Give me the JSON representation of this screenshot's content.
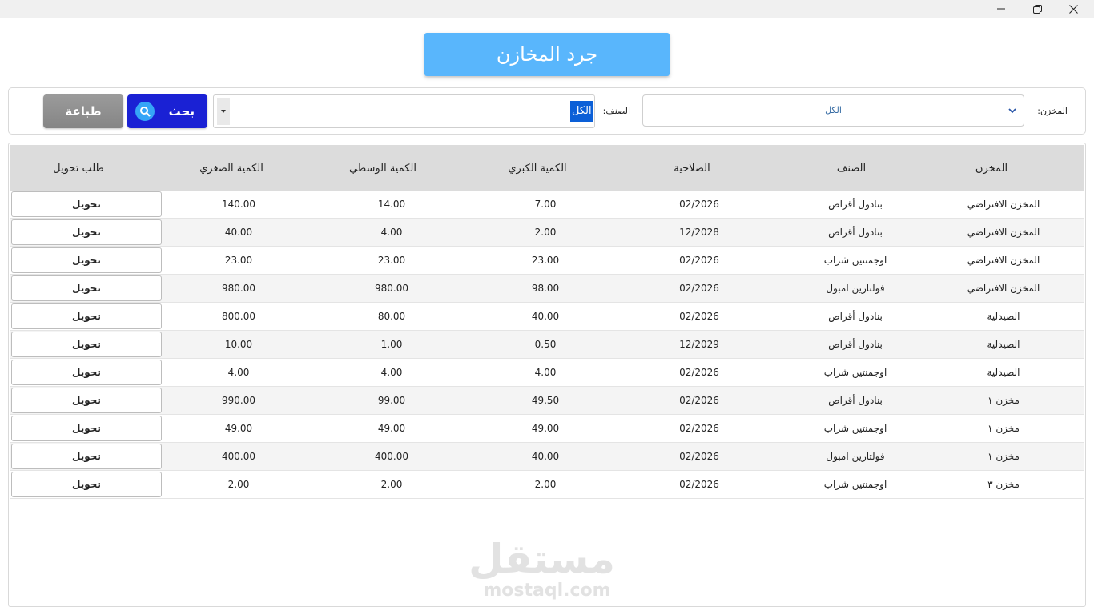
{
  "window": {
    "minimize_icon": "minimize-icon",
    "maximize_icon": "restore-icon",
    "close_icon": "close-icon"
  },
  "page_title": "جرد المخازن",
  "filters": {
    "store_label": "المخزن:",
    "store_value": "الكل",
    "class_label": "الصنف:",
    "class_value": "الكل",
    "search_label": "بحث",
    "print_label": "طباعة"
  },
  "colors": {
    "title_banner": "#59b6fc",
    "search_button": "#1a21d4",
    "print_button": "#8e8e8e",
    "selection": "#0b5fd7"
  },
  "table": {
    "headers": {
      "store": "المخزن",
      "item": "الصنف",
      "expiry": "الصلاحية",
      "qty_large": "الكمية الكبري",
      "qty_medium": "الكمية الوسطي",
      "qty_small": "الكمية الصغري",
      "transfer": "طلب تحويل"
    },
    "transfer_label": "تحويل",
    "rows": [
      {
        "store": "المخزن الافتراضي",
        "item": "بنادول أقراص",
        "expiry": "02/2026",
        "qty_large": "7.00",
        "qty_medium": "14.00",
        "qty_small": "140.00"
      },
      {
        "store": "المخزن الافتراضي",
        "item": "بنادول أقراص",
        "expiry": "12/2028",
        "qty_large": "2.00",
        "qty_medium": "4.00",
        "qty_small": "40.00"
      },
      {
        "store": "المخزن الافتراضي",
        "item": "اوجمنتين شراب",
        "expiry": "02/2026",
        "qty_large": "23.00",
        "qty_medium": "23.00",
        "qty_small": "23.00"
      },
      {
        "store": "المخزن الافتراضي",
        "item": "فولتارين امبول",
        "expiry": "02/2026",
        "qty_large": "98.00",
        "qty_medium": "980.00",
        "qty_small": "980.00"
      },
      {
        "store": "الصيدلية",
        "item": "بنادول أقراص",
        "expiry": "02/2026",
        "qty_large": "40.00",
        "qty_medium": "80.00",
        "qty_small": "800.00"
      },
      {
        "store": "الصيدلية",
        "item": "بنادول أقراص",
        "expiry": "12/2029",
        "qty_large": "0.50",
        "qty_medium": "1.00",
        "qty_small": "10.00"
      },
      {
        "store": "الصيدلية",
        "item": "اوجمنتين شراب",
        "expiry": "02/2026",
        "qty_large": "4.00",
        "qty_medium": "4.00",
        "qty_small": "4.00"
      },
      {
        "store": "مخزن ١",
        "item": "بنادول أقراص",
        "expiry": "02/2026",
        "qty_large": "49.50",
        "qty_medium": "99.00",
        "qty_small": "990.00"
      },
      {
        "store": "مخزن ١",
        "item": "اوجمنتين شراب",
        "expiry": "02/2026",
        "qty_large": "49.00",
        "qty_medium": "49.00",
        "qty_small": "49.00"
      },
      {
        "store": "مخزن ١",
        "item": "فولتارين امبول",
        "expiry": "02/2026",
        "qty_large": "40.00",
        "qty_medium": "400.00",
        "qty_small": "400.00"
      },
      {
        "store": "مخزن ٣",
        "item": "اوجمنتين شراب",
        "expiry": "02/2026",
        "qty_large": "2.00",
        "qty_medium": "2.00",
        "qty_small": "2.00"
      }
    ]
  },
  "watermark": {
    "arabic": "مستقل",
    "latin": "mostaql.com"
  }
}
